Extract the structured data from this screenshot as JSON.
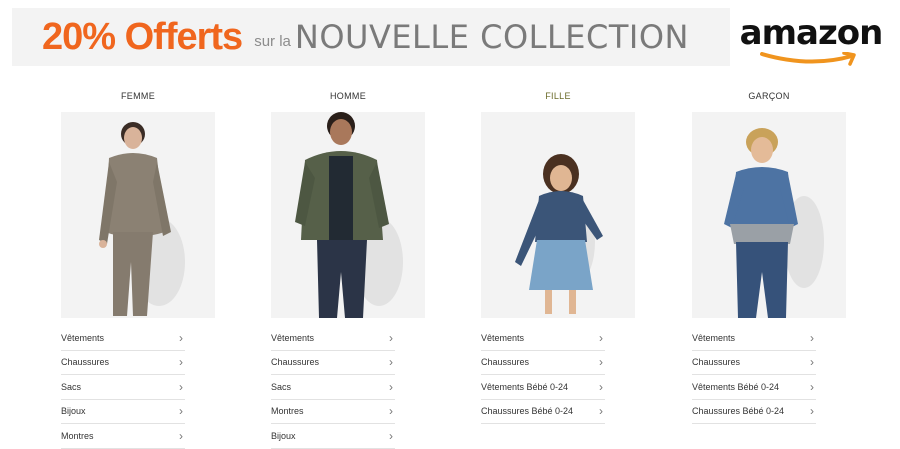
{
  "banner": {
    "discount": "20% Offerts",
    "connector": "sur la",
    "collection": "NOUVELLE COLLECTION",
    "brand": "amazon",
    "accent_color": "#f0661e",
    "smile_color": "#f0941e"
  },
  "columns": [
    {
      "title": "FEMME",
      "title_color": "#333333",
      "items": [
        "Vêtements",
        "Chaussures",
        "Sacs",
        "Bijoux",
        "Montres"
      ]
    },
    {
      "title": "HOMME",
      "title_color": "#333333",
      "items": [
        "Vêtements",
        "Chaussures",
        "Sacs",
        "Montres",
        "Bijoux"
      ]
    },
    {
      "title": "FILLE",
      "title_color": "#6b6b2a",
      "items": [
        "Vêtements",
        "Chaussures",
        "Vêtements Bébé 0-24",
        "Chaussures Bébé 0-24"
      ]
    },
    {
      "title": "GARÇON",
      "title_color": "#333333",
      "items": [
        "Vêtements",
        "Chaussures",
        "Vêtements Bébé 0-24",
        "Chaussures Bébé 0-24"
      ]
    }
  ],
  "chevron_icon": "chevron-right-icon"
}
